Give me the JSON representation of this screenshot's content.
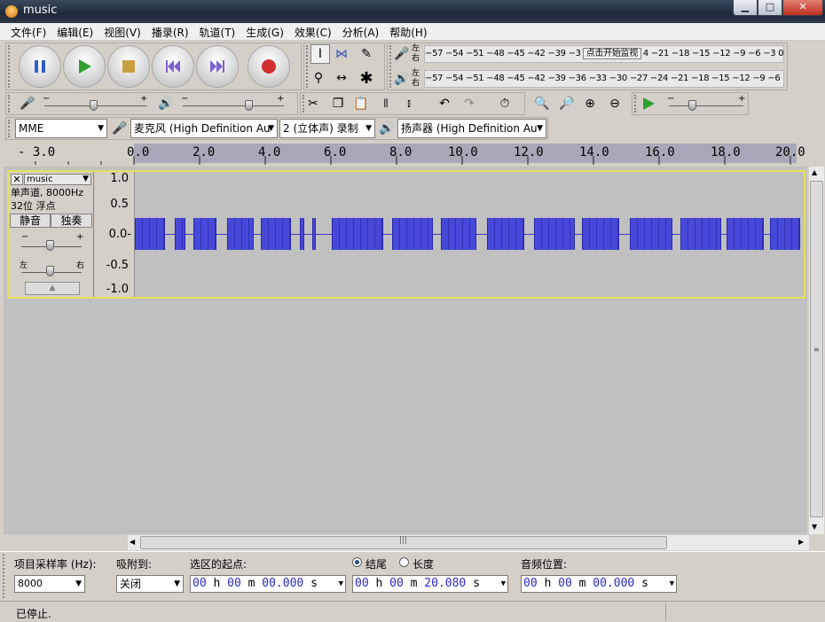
{
  "window": {
    "title": "music",
    "minimize": "▁",
    "maximize": "□",
    "close": "✕"
  },
  "menu": [
    "文件(F)",
    "编辑(E)",
    "视图(V)",
    "播录(R)",
    "轨道(T)",
    "生成(G)",
    "效果(C)",
    "分析(A)",
    "帮助(H)"
  ],
  "transport": {
    "pause": "pause-icon",
    "play": "play-icon",
    "stop": "stop-icon",
    "skip_start": "skip-start-icon",
    "skip_end": "skip-end-icon",
    "record": "record-icon"
  },
  "meters": {
    "record": {
      "left": "左",
      "right": "右",
      "scale_left": "−57 −54 −51 −48 −45 −42 −39 −3",
      "click_text": "点击开始监视",
      "scale_right": "4 −21 −18 −15 −12  −9  −6  −3  0"
    },
    "play": {
      "left": "左",
      "right": "右",
      "scale": "−57 −54 −51 −48 −45 −42 −39 −36 −33 −30 −27 −24 −21 −18 −15 −12  −9  −6  −3  0"
    }
  },
  "mixer": {
    "slider_plus": "+",
    "slider_minus": "−"
  },
  "devices": {
    "host": "MME",
    "mic": "麦克风 (High Definition Au",
    "channels": "2 (立体声) 录制",
    "speaker": "扬声器 (High Definition Au"
  },
  "ruler": [
    "- 3.0",
    "0.0",
    "2.0",
    "4.0",
    "6.0",
    "8.0",
    "10.0",
    "12.0",
    "14.0",
    "16.0",
    "18.0",
    "20.0"
  ],
  "track": {
    "name": "music",
    "info_line1": "单声道, 8000Hz",
    "info_line2": "32位 浮点",
    "mute": "静音",
    "solo": "独奏",
    "gain_minus": "−",
    "gain_plus": "+",
    "pan_left": "左",
    "pan_right": "右",
    "vscale": [
      "1.0",
      "0.5",
      "0.0-",
      "-0.5",
      "-1.0"
    ]
  },
  "selection": {
    "rate_label": "项目采样率 (Hz):",
    "rate_value": "8000",
    "snap_label": "吸附到:",
    "snap_value": "关闭",
    "start_label": "选区的起点:",
    "end_label": "结尾",
    "length_label": "长度",
    "audio_pos_label": "音频位置:",
    "start": {
      "h": "00",
      "m": "00",
      "s": "00.000"
    },
    "end": {
      "h": "00",
      "m": "00",
      "s": "20.080"
    },
    "pos": {
      "h": "00",
      "m": "00",
      "s": "00.000"
    },
    "unit_h": "h",
    "unit_m": "m",
    "unit_s": "s"
  },
  "status": "已停止."
}
